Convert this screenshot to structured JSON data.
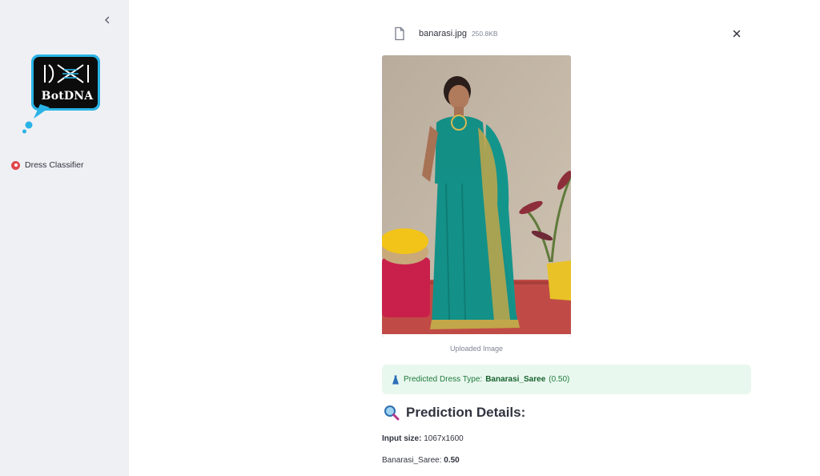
{
  "sidebar": {
    "logo_text": "BotDNA",
    "nav_items": [
      {
        "label": "Dress Classifier",
        "icon": "red-dot-icon",
        "active": true
      }
    ]
  },
  "upload": {
    "file_name": "banarasi.jpg",
    "file_size": "250.8KB"
  },
  "image": {
    "caption": "Uploaded Image"
  },
  "result": {
    "prefix": "Predicted Dress Type:",
    "label": "Banarasi_Saree",
    "confidence": "(0.50)"
  },
  "details": {
    "heading": "Prediction Details:",
    "input_size_label": "Input size:",
    "input_size_value": "1067x1600",
    "class_label": "Banarasi_Saree:",
    "class_value": "0.50"
  },
  "colors": {
    "sidebar_bg": "#eef0f4",
    "accent_red": "#e0474c",
    "success_bg": "#e9f8ee",
    "success_text": "#1f7a3c",
    "logo_blue": "#29b3e6"
  }
}
